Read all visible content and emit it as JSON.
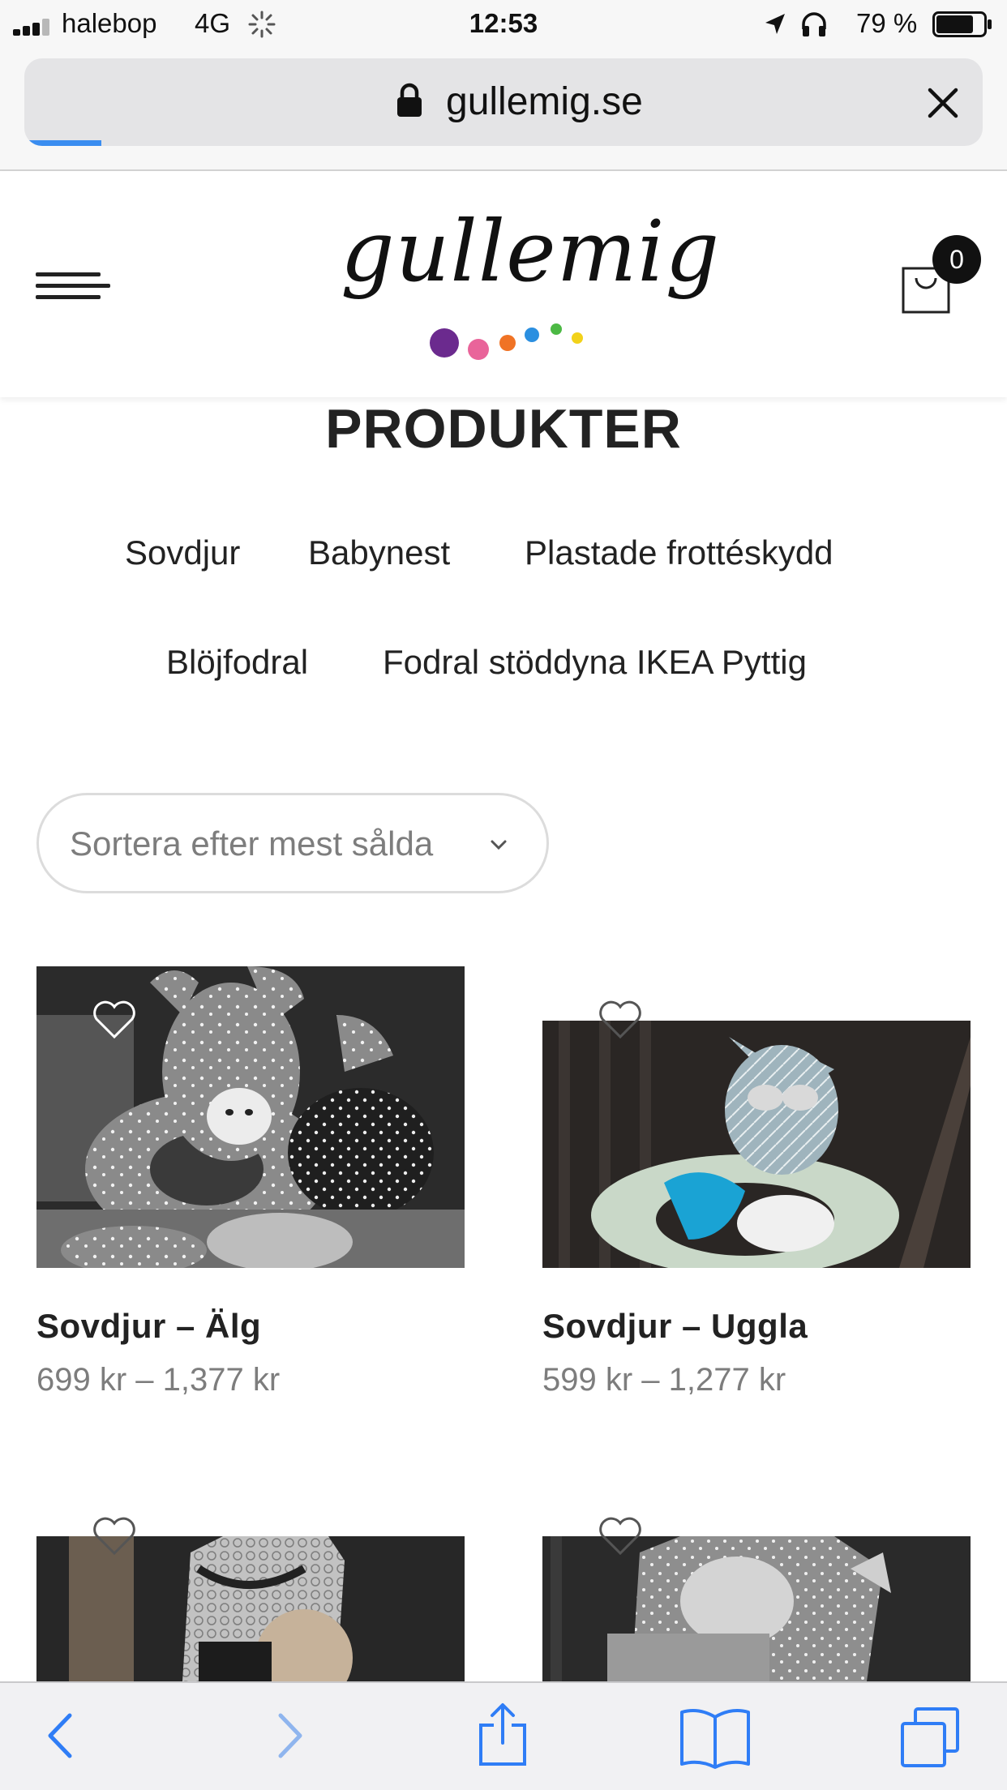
{
  "status_bar": {
    "carrier": "halebop",
    "network": "4G",
    "time": "12:53",
    "battery_percent": "79 %",
    "battery_level": 0.79,
    "signal_bars_filled": 3,
    "icons": [
      "signal-icon",
      "activity-spinner-icon",
      "location-arrow-icon",
      "headphones-icon",
      "battery-icon"
    ]
  },
  "browser": {
    "url": "gullemig.se",
    "page_load_progress": 0.08,
    "icons": [
      "lock-icon",
      "close-icon"
    ]
  },
  "header": {
    "logo_text": "gullemig",
    "cart_count": "0",
    "logo_dot_colors": [
      "#6b2a8e",
      "#e9649a",
      "#f07325",
      "#2b8fe0",
      "#4cb944",
      "#f2d21a"
    ],
    "icons": [
      "hamburger-menu-icon",
      "shopping-bag-icon"
    ]
  },
  "main": {
    "title": "PRODUKTER",
    "categories": [
      {
        "label": "Sovdjur"
      },
      {
        "label": "Babynest"
      },
      {
        "label": "Plastade frottéskydd"
      },
      {
        "label": "Blöjfodral"
      },
      {
        "label": "Fodral stöddyna IKEA Pyttig"
      }
    ],
    "sort": {
      "label": "Sortera efter mest sålda"
    },
    "products": [
      {
        "name": "Sovdjur – Älg",
        "price": "699 kr – 1,377 kr"
      },
      {
        "name": "Sovdjur – Uggla",
        "price": "599 kr – 1,277 kr"
      },
      {
        "name": "",
        "price": ""
      },
      {
        "name": "",
        "price": ""
      }
    ]
  },
  "toolbar": {
    "icons": [
      "back-icon",
      "forward-icon",
      "share-icon",
      "bookmarks-icon",
      "tabs-icon"
    ]
  },
  "colors": {
    "accent_progress": "#3a8df0",
    "toolbar_tint": "#2f7df6",
    "text": "#222222",
    "price": "#7d7d7d"
  }
}
